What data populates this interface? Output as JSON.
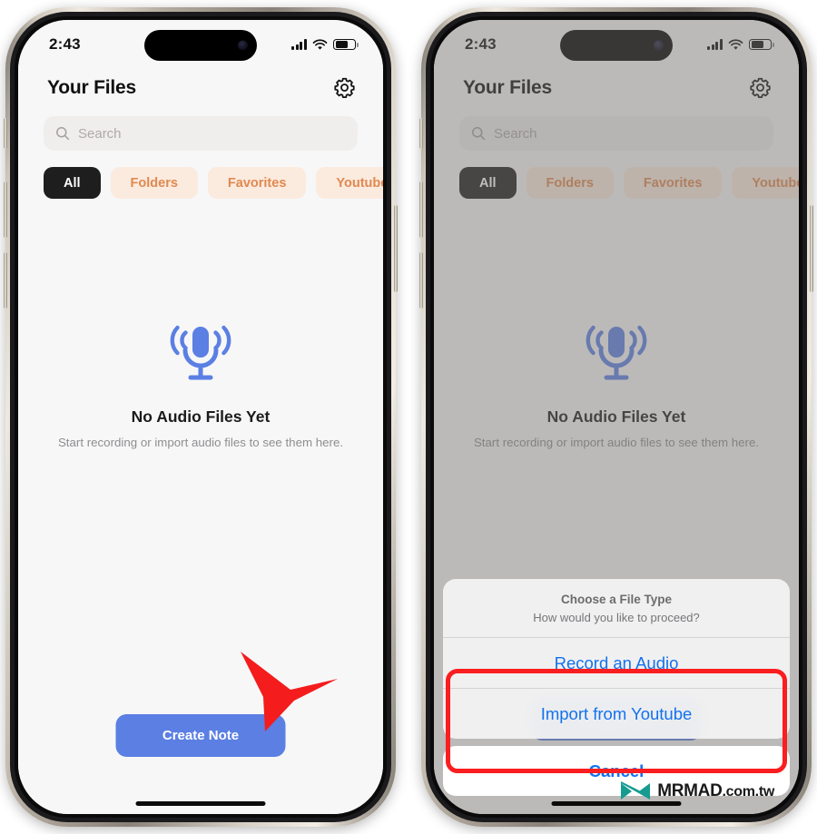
{
  "app": {
    "status_bar": {
      "time": "2:43",
      "battery_level": "60",
      "signal_bars": "4",
      "wifi": "wifi-icon"
    },
    "nav": {
      "title": "Your Files",
      "settings_icon": "gear-icon"
    },
    "search": {
      "placeholder": "Search",
      "value": "",
      "icon": "search-icon"
    },
    "filters": [
      {
        "label": "All",
        "active": true
      },
      {
        "label": "Folders",
        "active": false
      },
      {
        "label": "Favorites",
        "active": false
      },
      {
        "label": "Youtube",
        "active": false
      }
    ],
    "empty_state": {
      "icon": "microphone-icon",
      "title": "No Audio Files Yet",
      "subtitle": "Start recording or import audio files to see them here."
    },
    "cta": {
      "label": "Create Note"
    }
  },
  "action_sheet": {
    "title": "Choose a File Type",
    "message": "How would you like to proceed?",
    "options": [
      {
        "label": "Record an Audio"
      },
      {
        "label": "Import from Youtube"
      }
    ],
    "cancel": {
      "label": "Cancel"
    }
  },
  "annotations": {
    "arrow": {
      "name": "red-arrow-pointer",
      "color": "#f41c1c"
    },
    "highlight": {
      "name": "red-highlight-box",
      "color": "#fa1e20"
    }
  },
  "watermark": {
    "brand": "MRMAD",
    "tld": ".com.tw",
    "logo": "mrmad-logo-icon",
    "logo_color": "#169b91"
  },
  "theme": {
    "screen_bg": "#f7f7f8",
    "accent_blue": "#5b7fe3",
    "link_blue": "#1272ef",
    "chip_bg": "#fbeade",
    "chip_text": "#e0894f",
    "chip_active_bg": "#1e1e1e",
    "mic_blue": "#5b7fe3"
  }
}
